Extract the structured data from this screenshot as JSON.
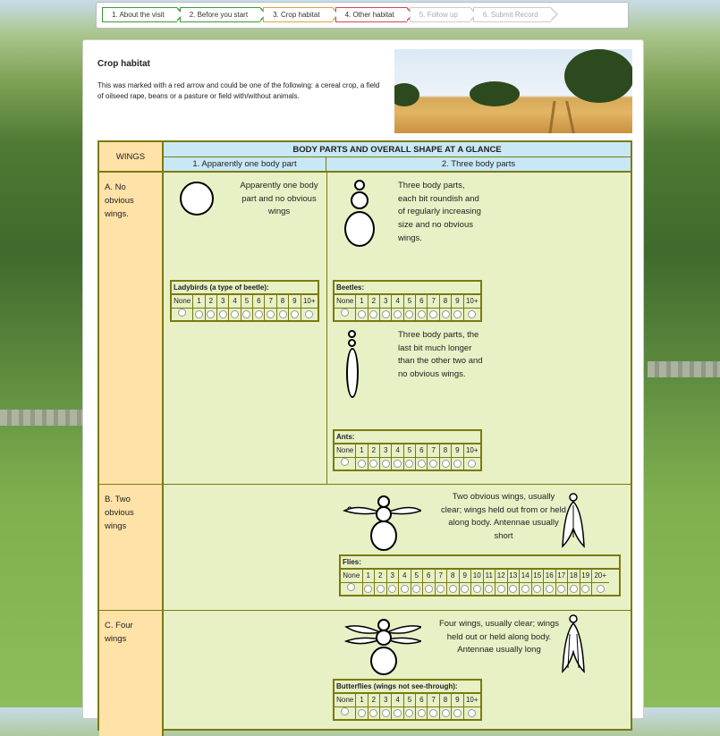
{
  "steps": [
    {
      "label": "1. About the visit"
    },
    {
      "label": "2. Before you start"
    },
    {
      "label": "3. Crop habitat"
    },
    {
      "label": "4. Other habitat"
    },
    {
      "label": "5. Follow up"
    },
    {
      "label": "6. Submit Record"
    }
  ],
  "page": {
    "title": "Crop habitat",
    "intro": "This was marked with a red arrow and could be one of the following: a cereal crop, a field of oilseed rape, beans or a pasture or field with/without animals."
  },
  "table": {
    "wings_header": "WINGS",
    "body_header": "BODY PARTS AND OVERALL SHAPE AT A GLANCE",
    "col1": "1. Apparently one body part",
    "col2": "2. Three body parts",
    "rows": [
      {
        "wings": "A. No obvious wings."
      },
      {
        "wings": "B. Two obvious wings"
      },
      {
        "wings": "C. Four wings"
      }
    ],
    "desc_one_body": "Apparently one body part and no obvious wings",
    "desc_three_round": "Three body parts, each bit roundish and of regularly increasing size and no obvious wings.",
    "desc_three_long": "Three body parts, the last bit much longer than the other two and no obvious wings.",
    "desc_two_wings": "Two obvious wings, usually clear; wings held out from or held along body. Antennae usually short",
    "desc_four_wings": "Four wings, usually clear; wings held out or held along body. Antennae usually long"
  },
  "counters": {
    "ladybirds": {
      "title": "Ladybirds (a type of beetle):"
    },
    "beetles": {
      "title": "Beetles:"
    },
    "ants": {
      "title": "Ants:"
    },
    "flies": {
      "title": "Flies:"
    },
    "butterflies": {
      "title": "Butterflies (wings not see-through):"
    }
  },
  "counts_10": [
    "None",
    "1",
    "2",
    "3",
    "4",
    "5",
    "6",
    "7",
    "8",
    "9",
    "10+"
  ],
  "counts_20": [
    "None",
    "1",
    "2",
    "3",
    "4",
    "5",
    "6",
    "7",
    "8",
    "9",
    "10",
    "11",
    "12",
    "13",
    "14",
    "15",
    "16",
    "17",
    "18",
    "19",
    "20+"
  ],
  "colors": {
    "table_border": "#7a7a10",
    "wings_col": "#fee2a8",
    "header": "#c9e8f5",
    "cell": "#e7f1c5"
  }
}
